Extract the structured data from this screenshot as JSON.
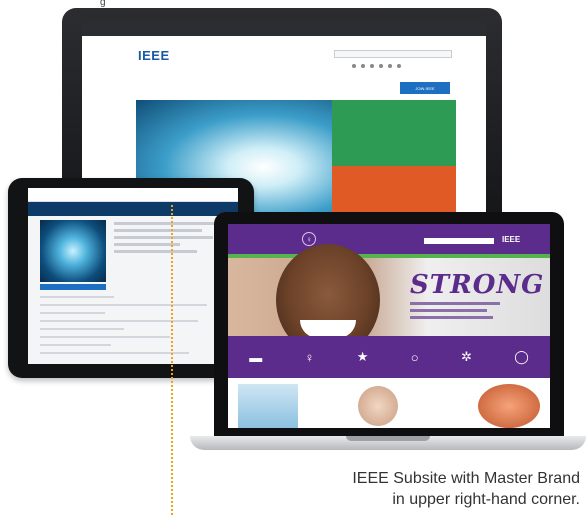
{
  "caption": {
    "line1": "IEEE Subsite with Master Brand",
    "line2": "in upper right-hand corner."
  },
  "top_crop_text": "g",
  "imac": {
    "logo": "IEEE",
    "join_button": "JOIN IEEE"
  },
  "macbook": {
    "hero_word": "STRONG",
    "ieee_brand": "IEEE"
  },
  "colors": {
    "accent_purple": "#5c2c8c",
    "ieee_blue": "#1b5aa5",
    "green_panel": "#2e9b55",
    "orange_panel": "#e05a26",
    "annotation_line": "#f0a21c"
  }
}
